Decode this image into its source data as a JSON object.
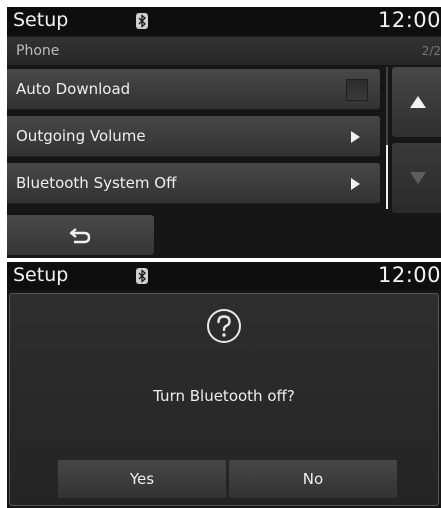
{
  "screens": [
    {
      "status": {
        "title": "Setup",
        "clock": "12:00",
        "bluetooth_icon": "bluetooth-icon"
      },
      "subheader": {
        "title": "Phone",
        "page": "2/2"
      },
      "items": [
        {
          "label": "Auto Download",
          "control": "checkbox",
          "checked": false
        },
        {
          "label": "Outgoing Volume",
          "control": "arrow-right-icon"
        },
        {
          "label": "Bluetooth System Off",
          "control": "arrow-right-icon"
        }
      ],
      "scroll": {
        "up_icon": "arrow-up-icon",
        "down_icon": "arrow-down-icon",
        "down_enabled": false
      },
      "back_icon": "back-arrow-icon"
    },
    {
      "status": {
        "title": "Setup",
        "clock": "12:00",
        "bluetooth_icon": "bluetooth-icon"
      },
      "dialog": {
        "icon": "question-icon",
        "message": "Turn Bluetooth off?",
        "yes_label": "Yes",
        "no_label": "No"
      }
    }
  ],
  "colors": {
    "background": "#161616",
    "button": "#404040",
    "text": "#efefef"
  }
}
